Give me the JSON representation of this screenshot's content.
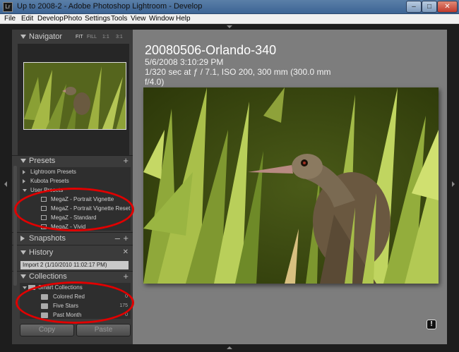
{
  "window": {
    "app_icon": "Lr",
    "title": "Up to 2008-2 - Adobe Photoshop Lightroom - Develop",
    "min_glyph": "–",
    "max_glyph": "□",
    "close_glyph": "✕"
  },
  "menu": {
    "items": [
      "File",
      "Edit",
      "Develop",
      "Photo",
      "Settings",
      "Tools",
      "View",
      "Window",
      "Help"
    ]
  },
  "navigator": {
    "title": "Navigator",
    "options": [
      "FIT",
      "FILL",
      "1:1",
      "3:1"
    ]
  },
  "presets": {
    "title": "Presets",
    "add_glyph": "+",
    "folders": [
      "Lightroom Presets",
      "Kubota Presets",
      "User Presets"
    ],
    "user_presets": [
      "MegaZ - Portrait Vignette",
      "MegaZ - Portrait Vignette Reset",
      "MegaZ - Standard",
      "MegaZ - Vivid"
    ]
  },
  "snapshots": {
    "title": "Snapshots",
    "minus_glyph": "–",
    "add_glyph": "+"
  },
  "history": {
    "title": "History",
    "clear_glyph": "✕",
    "entry": "Import 2 (1/10/2010 11:02:17 PM)"
  },
  "collections": {
    "title": "Collections",
    "add_glyph": "+",
    "group": "Smart Collections",
    "items": [
      {
        "label": "Colored Red",
        "count": "0"
      },
      {
        "label": "Five Stars",
        "count": "175"
      },
      {
        "label": "Past Month",
        "count": "0"
      }
    ]
  },
  "buttons": {
    "copy": "Copy",
    "paste": "Paste"
  },
  "photo": {
    "name": "20080506-Orlando-340",
    "date": "5/6/2008 3:10:29 PM",
    "exposure_line1": "1/320 sec at ƒ / 7.1, ISO 200, 300 mm (300.0 mm",
    "exposure_line2": "f/4.0)",
    "info_glyph": "!"
  },
  "icons": [
    "app-icon",
    "minimize-icon",
    "maximize-icon",
    "close-icon",
    "panel-collapse-icon",
    "plus-icon",
    "document-icon",
    "collection-icon",
    "info-icon"
  ],
  "colors": {
    "annotation_ring": "#e00000",
    "history_selected": "#c9c9c9"
  }
}
